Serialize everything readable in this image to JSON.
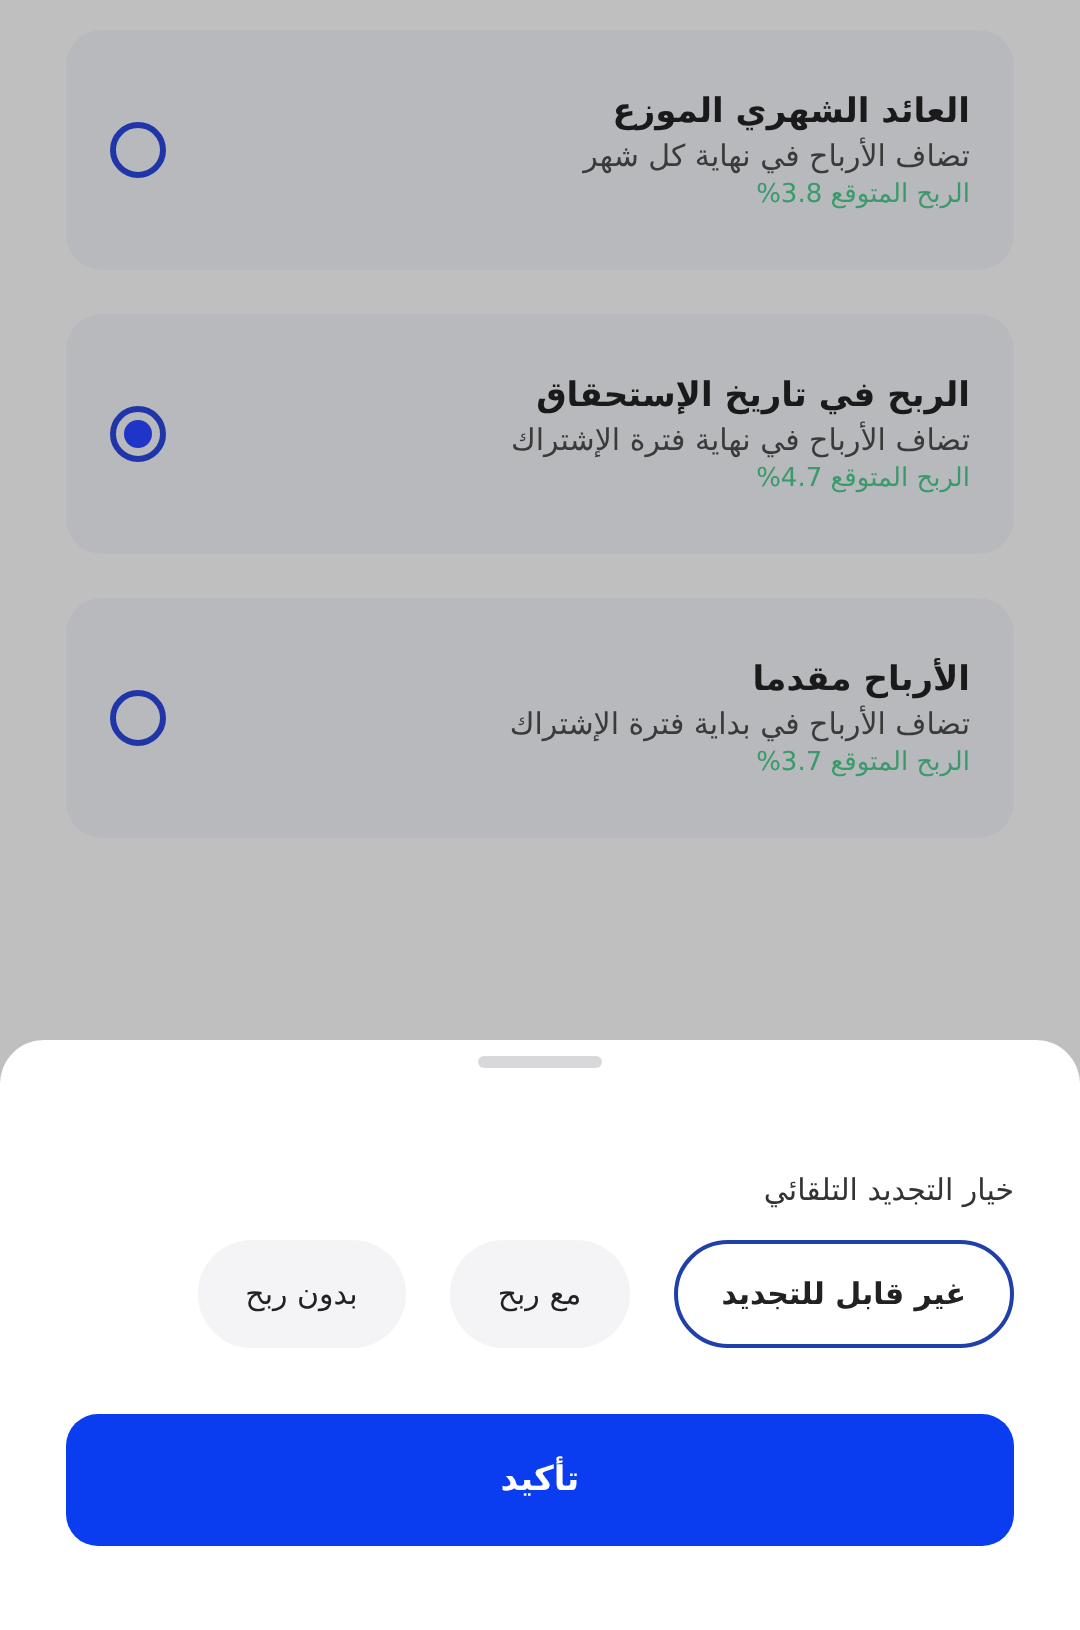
{
  "plans": [
    {
      "title": "العائد الشهري الموزع",
      "description": "تضاف الأرباح في نهاية كل شهر",
      "expected_profit": "الربح المتوقع 3.8%",
      "selected": false
    },
    {
      "title": "الربح في تاريخ الإستحقاق",
      "description": "تضاف الأرباح في نهاية فترة الإشتراك",
      "expected_profit": "الربح المتوقع 4.7%",
      "selected": true
    },
    {
      "title": "الأرباح مقدما",
      "description": "تضاف الأرباح في بداية فترة الإشتراك",
      "expected_profit": "الربح المتوقع 3.7%",
      "selected": false
    }
  ],
  "sheet": {
    "label": "خيار التجديد التلقائي",
    "options": [
      {
        "label": "غير قابل للتجديد",
        "selected": true
      },
      {
        "label": "مع ربح",
        "selected": false
      },
      {
        "label": "بدون ربح",
        "selected": false
      }
    ],
    "confirm_button": "تأكيد"
  }
}
